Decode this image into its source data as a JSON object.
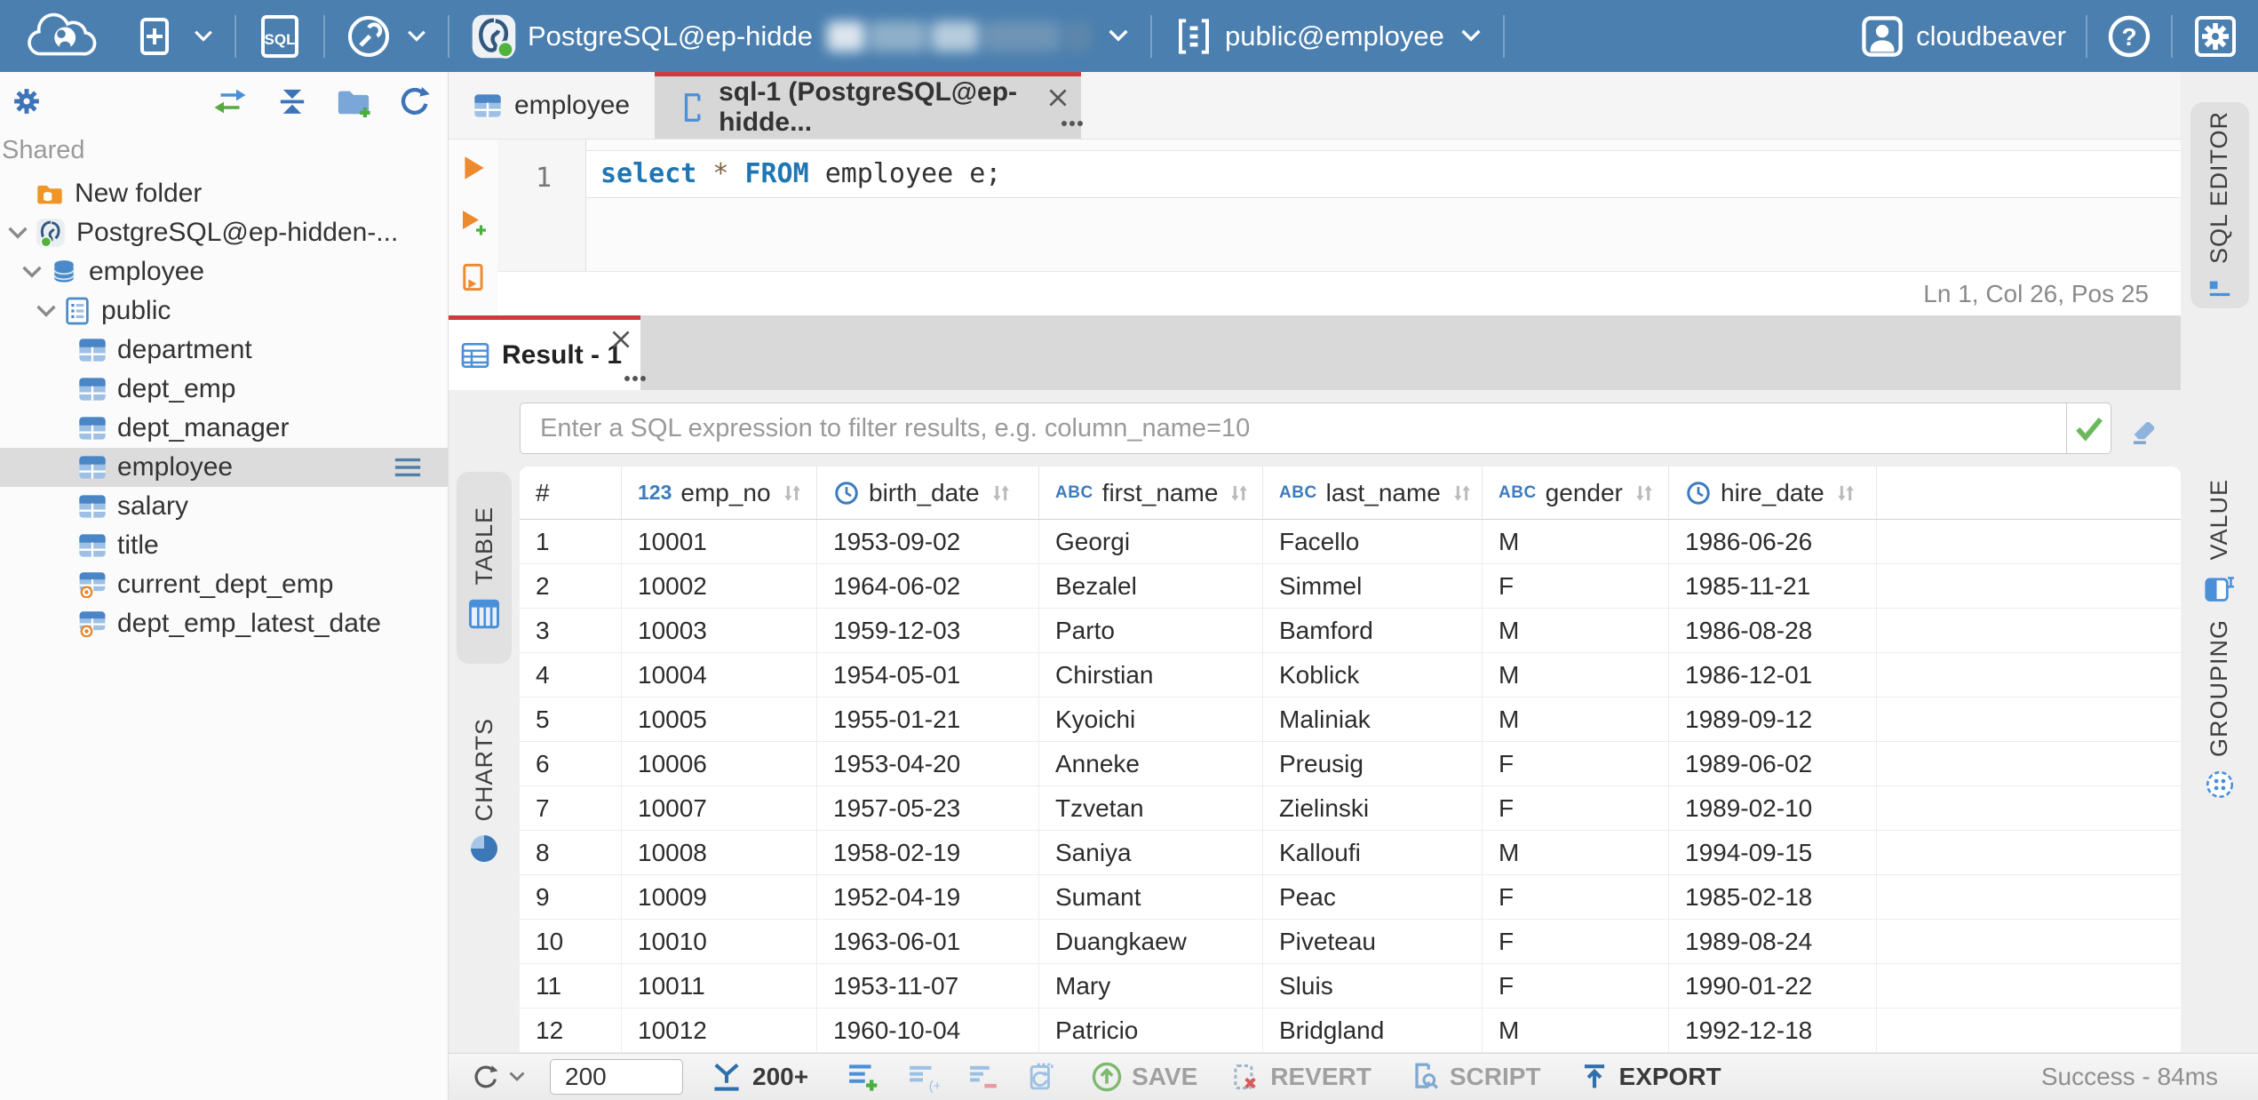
{
  "colors": {
    "topbar_blue": "#4a7fb0",
    "accent_red": "#cb3d3d",
    "icon_blue": "#3b7bbf",
    "green": "#58a942",
    "orange": "#ee8a2e"
  },
  "topbar": {
    "connection": {
      "label": "PostgreSQL@ep-hidde",
      "icon": "postgres-icon",
      "redacted": true
    },
    "schema": {
      "label": "public@employee",
      "icon": "schema-list-icon"
    },
    "user": {
      "name": "cloudbeaver",
      "icon": "avatar-icon"
    }
  },
  "sidebar": {
    "section_label": "Shared",
    "items": [
      {
        "label": "New folder",
        "icon": "folder-db-icon"
      },
      {
        "label": "PostgreSQL@ep-hidden-...",
        "icon": "postgres-icon",
        "expanded": true,
        "status": "connected"
      },
      {
        "label": "employee",
        "icon": "database-icon",
        "expanded": true
      },
      {
        "label": "public",
        "icon": "schema-icon",
        "expanded": true
      },
      {
        "label": "department",
        "icon": "table-icon"
      },
      {
        "label": "dept_emp",
        "icon": "table-icon"
      },
      {
        "label": "dept_manager",
        "icon": "table-icon"
      },
      {
        "label": "employee",
        "icon": "table-icon",
        "selected": true
      },
      {
        "label": "salary",
        "icon": "table-icon"
      },
      {
        "label": "title",
        "icon": "table-icon"
      },
      {
        "label": "current_dept_emp",
        "icon": "view-icon"
      },
      {
        "label": "dept_emp_latest_date",
        "icon": "view-icon"
      }
    ]
  },
  "editor_tabs": [
    {
      "label": "employee",
      "icon": "table-icon"
    },
    {
      "label": "sql-1 (PostgreSQL@ep-hidde...",
      "icon": "sql-script-icon",
      "active": true
    }
  ],
  "editor": {
    "line_number": "1",
    "code": {
      "kw1": "select",
      "op": "*",
      "kw2": "FROM",
      "rest": "employee e;"
    },
    "status": "Ln 1, Col 26, Pos 25"
  },
  "result": {
    "tab_label": "Result - 1",
    "filter_placeholder": "Enter a SQL expression to filter results, e.g. column_name=10"
  },
  "side_tabs": {
    "table": "TABLE",
    "charts": "CHARTS",
    "sql_editor": "SQL EDITOR",
    "value": "VALUE",
    "grouping": "GROUPING"
  },
  "grid": {
    "type_icons": {
      "number": "123",
      "string": "ABC"
    },
    "columns": [
      {
        "label": "#",
        "type": ""
      },
      {
        "label": "emp_no",
        "type": "number"
      },
      {
        "label": "birth_date",
        "type": "datetime"
      },
      {
        "label": "first_name",
        "type": "string"
      },
      {
        "label": "last_name",
        "type": "string"
      },
      {
        "label": "gender",
        "type": "string"
      },
      {
        "label": "hire_date",
        "type": "datetime"
      }
    ],
    "rows": [
      [
        "1",
        "10001",
        "1953-09-02",
        "Georgi",
        "Facello",
        "M",
        "1986-06-26"
      ],
      [
        "2",
        "10002",
        "1964-06-02",
        "Bezalel",
        "Simmel",
        "F",
        "1985-11-21"
      ],
      [
        "3",
        "10003",
        "1959-12-03",
        "Parto",
        "Bamford",
        "M",
        "1986-08-28"
      ],
      [
        "4",
        "10004",
        "1954-05-01",
        "Chirstian",
        "Koblick",
        "M",
        "1986-12-01"
      ],
      [
        "5",
        "10005",
        "1955-01-21",
        "Kyoichi",
        "Maliniak",
        "M",
        "1989-09-12"
      ],
      [
        "6",
        "10006",
        "1953-04-20",
        "Anneke",
        "Preusig",
        "F",
        "1989-06-02"
      ],
      [
        "7",
        "10007",
        "1957-05-23",
        "Tzvetan",
        "Zielinski",
        "F",
        "1989-02-10"
      ],
      [
        "8",
        "10008",
        "1958-02-19",
        "Saniya",
        "Kalloufi",
        "M",
        "1994-09-15"
      ],
      [
        "9",
        "10009",
        "1952-04-19",
        "Sumant",
        "Peac",
        "F",
        "1985-02-18"
      ],
      [
        "10",
        "10010",
        "1963-06-01",
        "Duangkaew",
        "Piveteau",
        "F",
        "1989-08-24"
      ],
      [
        "11",
        "10011",
        "1953-11-07",
        "Mary",
        "Sluis",
        "F",
        "1990-01-22"
      ],
      [
        "12",
        "10012",
        "1960-10-04",
        "Patricio",
        "Bridgland",
        "M",
        "1992-12-18"
      ]
    ]
  },
  "toolbar": {
    "row_limit_value": "200",
    "fetch_more_label": "200+",
    "save_label": "SAVE",
    "revert_label": "REVERT",
    "script_label": "SCRIPT",
    "export_label": "EXPORT",
    "status": "Success - 84ms"
  }
}
